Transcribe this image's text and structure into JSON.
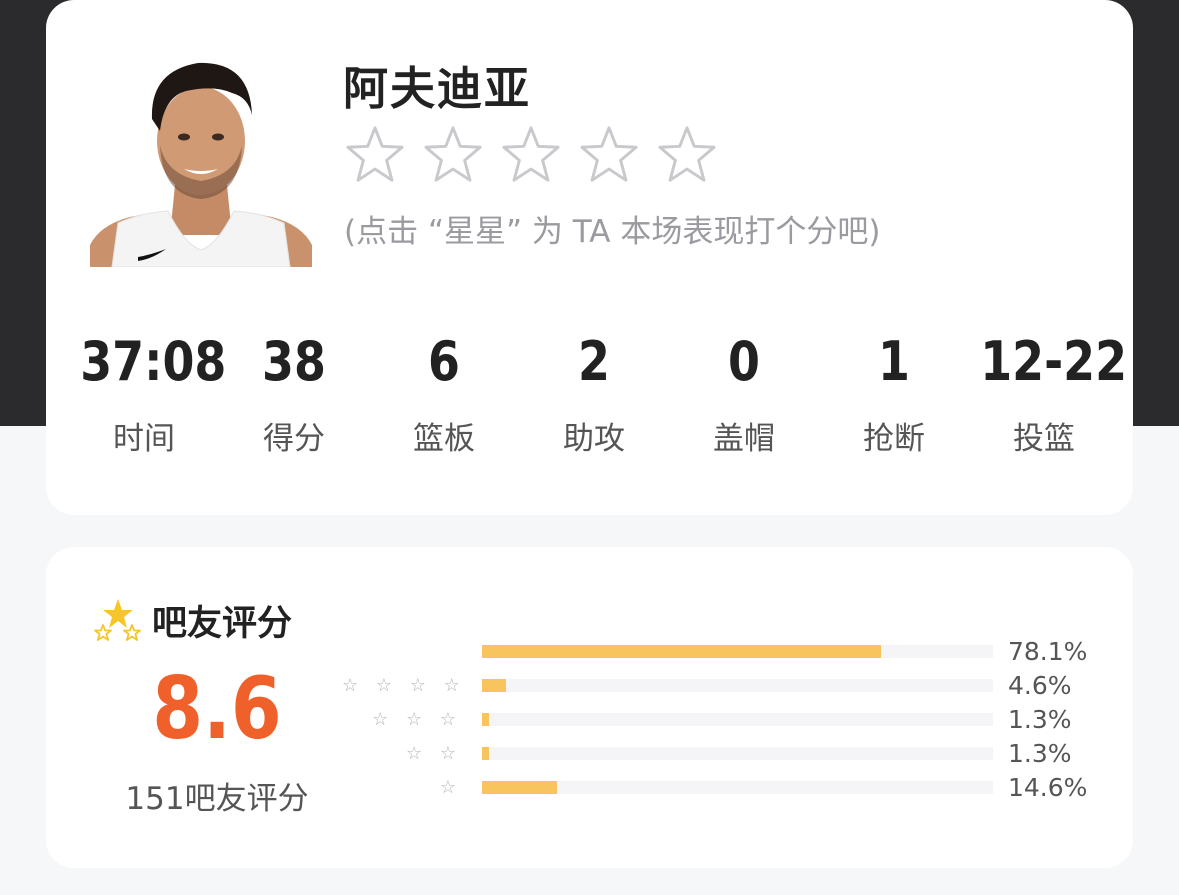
{
  "player": {
    "name": "阿夫迪亚",
    "hint": "(点击 “星星” 为 TA 本场表现打个分吧)"
  },
  "icons": [
    "player-photo",
    "star-outline-icon",
    "rating-stars-icon",
    "star-outline-small-icon"
  ],
  "colors": {
    "accent": "#f0602b",
    "bar": "#f8c45d",
    "star_gold": "#f7c529",
    "dark_bg": "#2b2b2d"
  },
  "stats": [
    {
      "value": "37:08",
      "label": "时间"
    },
    {
      "value": "38",
      "label": "得分"
    },
    {
      "value": "6",
      "label": "篮板"
    },
    {
      "value": "2",
      "label": "助攻"
    },
    {
      "value": "0",
      "label": "盖帽"
    },
    {
      "value": "1",
      "label": "抢断"
    },
    {
      "value": "12-22",
      "label": "投篮"
    }
  ],
  "rating": {
    "title": "吧友评分",
    "score": "8.6",
    "count": "151吧友评分",
    "distribution": [
      {
        "stars": "",
        "percent": "78.1%",
        "fraction": 0.781
      },
      {
        "stars": "☆ ☆ ☆ ☆",
        "percent": "4.6%",
        "fraction": 0.046
      },
      {
        "stars": "☆ ☆ ☆",
        "percent": "1.3%",
        "fraction": 0.013
      },
      {
        "stars": "☆ ☆",
        "percent": "1.3%",
        "fraction": 0.013
      },
      {
        "stars": "☆",
        "percent": "14.6%",
        "fraction": 0.146
      }
    ]
  }
}
